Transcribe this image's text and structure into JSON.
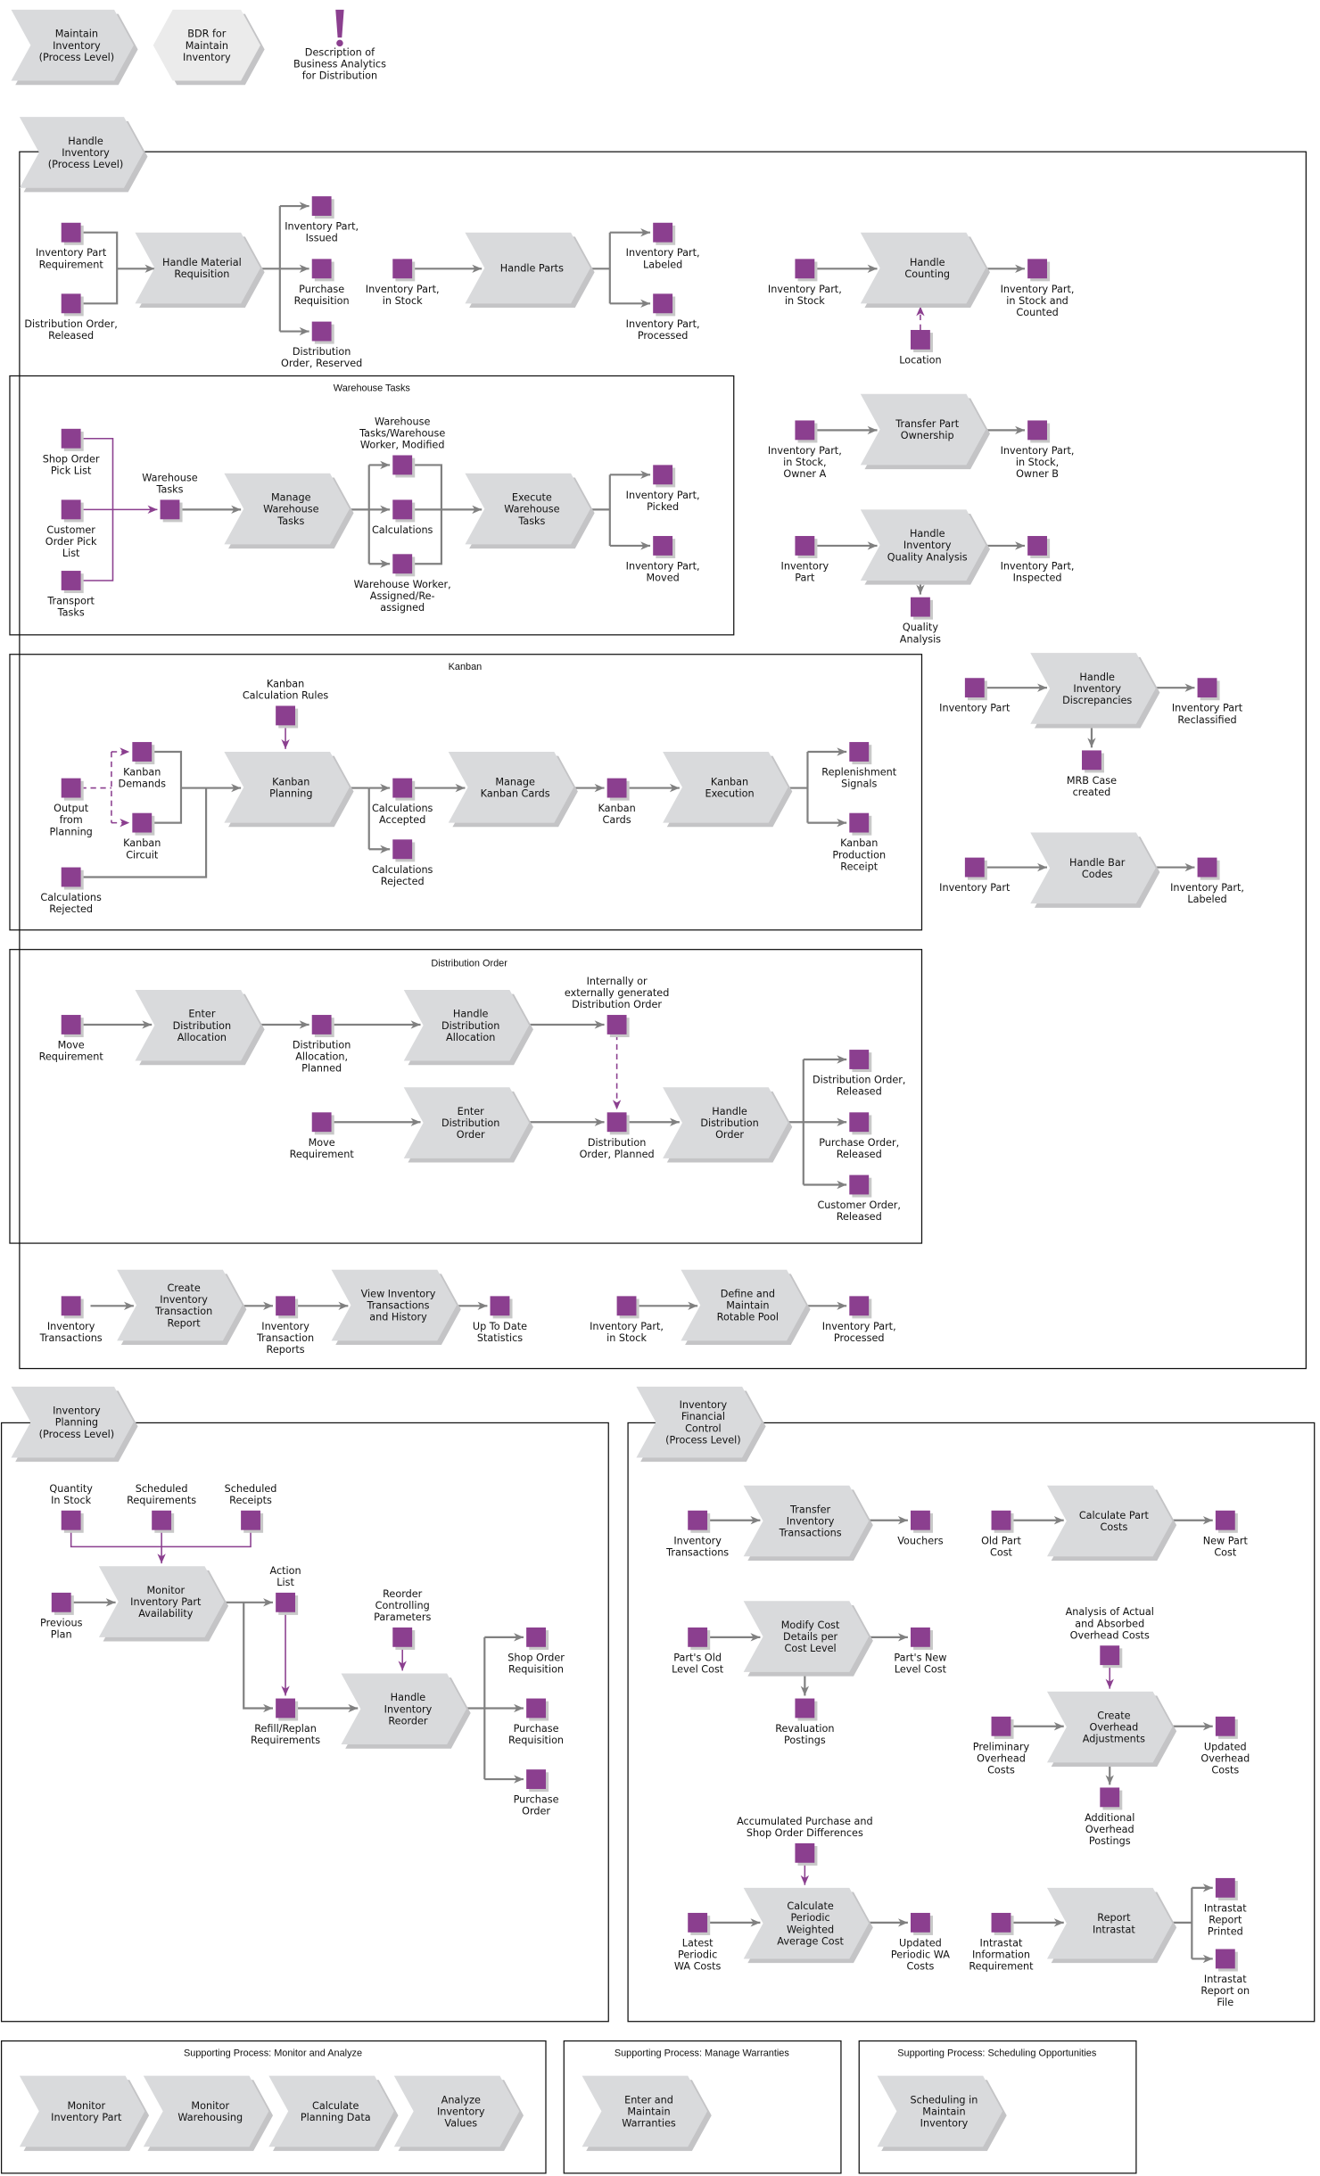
{
  "colors": {
    "event": "#8b3f8f",
    "function": "#d9dadc",
    "bdr": "#ebebeb",
    "connector": "#808080",
    "purple_connector": "#8b3f8f"
  },
  "icons": {
    "description": "exclamation-icon"
  },
  "frames": {
    "warehouse": "Warehouse Tasks",
    "kanban": "Kanban",
    "distribution": "Distribution Order",
    "sup_monitor": "Supporting Process: Monitor and Analyze",
    "sup_warranties": "Supporting Process: Manage Warranties",
    "sup_scheduling": "Supporting Process: Scheduling Opportunities"
  },
  "nodes": {
    "maintain_inventory": [
      "Maintain",
      "Inventory",
      "(Process Level)"
    ],
    "bdr": [
      "BDR for",
      "Maintain",
      "Inventory"
    ],
    "description": [
      "Description of",
      "Business Analytics",
      "for Distribution"
    ],
    "handle_inventory": [
      "Handle",
      "Inventory",
      "(Process Level)"
    ],
    "e_ipr": [
      "Inventory Part",
      "Requirement"
    ],
    "e_dor": [
      "Distribution Order,",
      "Released"
    ],
    "f_hmr": [
      "Handle Material",
      "Requisition"
    ],
    "e_ipi": [
      "Inventory Part,",
      "Issued"
    ],
    "e_pr": [
      "Purchase",
      "Requisition"
    ],
    "e_dores": [
      "Distribution",
      "Order, Reserved"
    ],
    "e_ips1": [
      "Inventory Part,",
      "in Stock"
    ],
    "f_hp": [
      "Handle Parts"
    ],
    "e_ipl": [
      "Inventory Part,",
      "Labeled"
    ],
    "e_ipp": [
      "Inventory Part,",
      "Processed"
    ],
    "e_ips2": [
      "Inventory Part,",
      "in Stock"
    ],
    "f_hc": [
      "Handle",
      "Counting"
    ],
    "e_ipsc": [
      "Inventory Part,",
      "in Stock and",
      "Counted"
    ],
    "e_loc": [
      "Location"
    ],
    "e_oa": [
      "Inventory Part,",
      "in Stock,",
      "Owner A"
    ],
    "f_tpo": [
      "Transfer Part",
      "Ownership"
    ],
    "e_ob": [
      "Inventory Part,",
      "in Stock,",
      "Owner B"
    ],
    "e_ip1": [
      "Inventory",
      "Part"
    ],
    "f_hiqa": [
      "Handle",
      "Inventory",
      "Quality Analysis"
    ],
    "e_ipins": [
      "Inventory Part,",
      "Inspected"
    ],
    "e_qa": [
      "Quality",
      "Analysis"
    ],
    "e_ip2": [
      "Inventory Part"
    ],
    "f_hid": [
      "Handle",
      "Inventory",
      "Discrepancies"
    ],
    "e_iprc": [
      "Inventory Part",
      "Reclassified"
    ],
    "e_mrb": [
      "MRB Case",
      "created"
    ],
    "e_ip3": [
      "Inventory Part"
    ],
    "f_hbc": [
      "Handle Bar",
      "Codes"
    ],
    "e_ipl2": [
      "Inventory Part,",
      "Labeled"
    ],
    "e_sopl": [
      "Shop Order",
      "Pick List"
    ],
    "e_copl": [
      "Customer",
      "Order Pick",
      "List"
    ],
    "e_tt": [
      "Transport",
      "Tasks"
    ],
    "e_wt": [
      "Warehouse",
      "Tasks"
    ],
    "f_mwt": [
      "Manage",
      "Warehouse",
      "Tasks"
    ],
    "e_wtm": [
      "Warehouse",
      "Tasks/Warehouse",
      "Worker, Modified"
    ],
    "e_calc": [
      "Calculations"
    ],
    "e_wwa": [
      "Warehouse Worker,",
      "Assigned/Re-",
      "assigned"
    ],
    "f_ewt": [
      "Execute",
      "Warehouse",
      "Tasks"
    ],
    "e_ippk": [
      "Inventory Part,",
      "Picked"
    ],
    "e_ipm": [
      "Inventory Part,",
      "Moved"
    ],
    "e_kcr": [
      "Kanban",
      "Calculation Rules"
    ],
    "f_kp": [
      "Kanban",
      "Planning"
    ],
    "e_ofp": [
      "Output",
      "from",
      "Planning"
    ],
    "e_kd": [
      "Kanban",
      "Demands"
    ],
    "e_kc": [
      "Kanban",
      "Circuit"
    ],
    "e_cr1": [
      "Calculations",
      "Rejected"
    ],
    "e_ca": [
      "Calculations",
      "Accepted"
    ],
    "e_cr2": [
      "Calculations",
      "Rejected"
    ],
    "f_mkc": [
      "Manage",
      "Kanban Cards"
    ],
    "e_kcards": [
      "Kanban",
      "Cards"
    ],
    "f_ke": [
      "Kanban",
      "Execution"
    ],
    "e_rs": [
      "Replenishment",
      "Signals"
    ],
    "e_kpr": [
      "Kanban",
      "Production",
      "Receipt"
    ],
    "e_mr1": [
      "Move",
      "Requirement"
    ],
    "f_eda": [
      "Enter",
      "Distribution",
      "Allocation"
    ],
    "e_dap": [
      "Distribution",
      "Allocation,",
      "Planned"
    ],
    "f_hda": [
      "Handle",
      "Distribution",
      "Allocation"
    ],
    "e_iegdo": [
      "Internally or",
      "externally generated",
      "Distribution Order"
    ],
    "e_mr2": [
      "Move",
      "Requirement"
    ],
    "f_edo": [
      "Enter",
      "Distribution",
      "Order"
    ],
    "e_dop": [
      "Distribution",
      "Order, Planned"
    ],
    "f_hdo": [
      "Handle",
      "Distribution",
      "Order"
    ],
    "e_dorel": [
      "Distribution Order,",
      "Released"
    ],
    "e_porel": [
      "Purchase Order,",
      "Released"
    ],
    "e_corel": [
      "Customer Order,",
      "Released"
    ],
    "e_it1": [
      "Inventory",
      "Transactions"
    ],
    "f_citr": [
      "Create",
      "Inventory",
      "Transaction",
      "Report"
    ],
    "e_itr": [
      "Inventory",
      "Transaction",
      "Reports"
    ],
    "f_vith": [
      "View Inventory",
      "Transactions",
      "and History"
    ],
    "e_utds": [
      "Up To Date",
      "Statistics"
    ],
    "e_ips3": [
      "Inventory Part,",
      "in Stock"
    ],
    "f_dmrp": [
      "Define and",
      "Maintain",
      "Rotable Pool"
    ],
    "e_ipp2": [
      "Inventory Part,",
      "Processed"
    ],
    "inventory_planning": [
      "Inventory",
      "Planning",
      "(Process Level)"
    ],
    "e_qis": [
      "Quantity",
      "In Stock"
    ],
    "e_sreq": [
      "Scheduled",
      "Requirements"
    ],
    "e_srec": [
      "Scheduled",
      "Receipts"
    ],
    "f_mipa": [
      "Monitor",
      "Inventory Part",
      "Availability"
    ],
    "e_pp": [
      "Previous",
      "Plan"
    ],
    "e_al": [
      "Action",
      "List"
    ],
    "e_rr": [
      "Refill/Replan",
      "Requirements"
    ],
    "e_rcp": [
      "Reorder",
      "Controlling",
      "Parameters"
    ],
    "f_hir": [
      "Handle",
      "Inventory",
      "Reorder"
    ],
    "e_sor": [
      "Shop Order",
      "Requisition"
    ],
    "e_pr2": [
      "Purchase",
      "Requisition"
    ],
    "e_po": [
      "Purchase",
      "Order"
    ],
    "inventory_financial": [
      "Inventory",
      "Financial",
      "Control",
      "(Process Level)"
    ],
    "e_it2": [
      "Inventory",
      "Transactions"
    ],
    "f_tit": [
      "Transfer",
      "Inventory",
      "Transactions"
    ],
    "e_vou": [
      "Vouchers"
    ],
    "e_opc": [
      "Old Part",
      "Cost"
    ],
    "f_cpc": [
      "Calculate Part",
      "Costs"
    ],
    "e_npc": [
      "New Part",
      "Cost"
    ],
    "e_polc": [
      "Part's Old",
      "Level Cost"
    ],
    "f_mcd": [
      "Modify Cost",
      "Details per",
      "Cost Level"
    ],
    "e_pnlc": [
      "Part's New",
      "Level Cost"
    ],
    "e_revp": [
      "Revaluation",
      "Postings"
    ],
    "e_aaoc": [
      "Analysis of Actual",
      "and Absorbed",
      "Overhead Costs"
    ],
    "f_coa": [
      "Create",
      "Overhead",
      "Adjustments"
    ],
    "e_poc": [
      "Preliminary",
      "Overhead",
      "Costs"
    ],
    "e_uoc": [
      "Updated",
      "Overhead",
      "Costs"
    ],
    "e_aop": [
      "Additional",
      "Overhead",
      "Postings"
    ],
    "e_apsod": [
      "Accumulated Purchase and",
      "Shop Order Differences"
    ],
    "f_cpwac": [
      "Calculate",
      "Periodic",
      "Weighted",
      "Average Cost"
    ],
    "e_lpwa": [
      "Latest",
      "Periodic",
      "WA Costs"
    ],
    "e_upwa": [
      "Updated",
      "Periodic WA",
      "Costs"
    ],
    "e_iir": [
      "Intrastat",
      "Information",
      "Requirement"
    ],
    "f_ri": [
      "Report",
      "Intrastat"
    ],
    "e_irp": [
      "Intrastat",
      "Report",
      "Printed"
    ],
    "e_irf": [
      "Intrastat",
      "Report on",
      "File"
    ],
    "s_mip": [
      "Monitor",
      "Inventory Part"
    ],
    "s_mw": [
      "Monitor",
      "Warehousing"
    ],
    "s_cpd": [
      "Calculate",
      "Planning Data"
    ],
    "s_aiv": [
      "Analyze",
      "Inventory",
      "Values"
    ],
    "s_emw": [
      "Enter and",
      "Maintain",
      "Warranties"
    ],
    "s_smi": [
      "Scheduling in",
      "Maintain",
      "Inventory"
    ]
  }
}
